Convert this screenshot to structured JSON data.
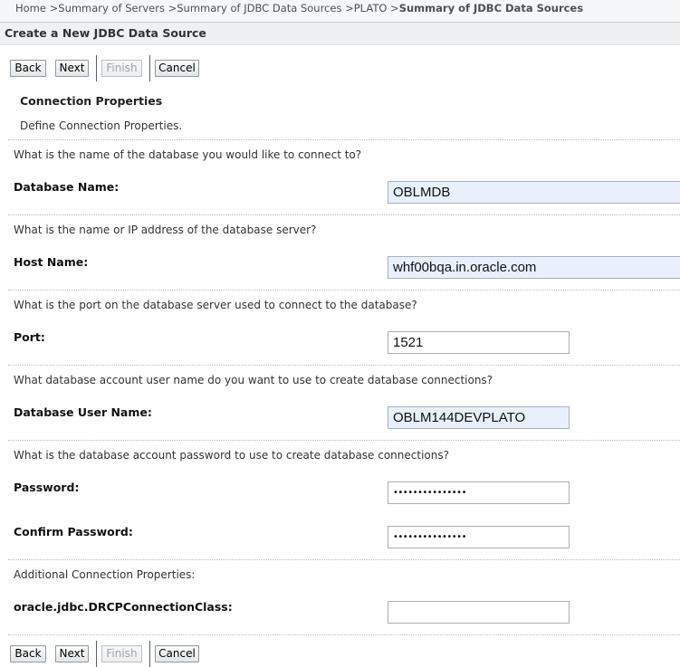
{
  "breadcrumb": {
    "items": [
      "Home",
      "Summary of Servers",
      "Summary of JDBC Data Sources",
      "PLATO"
    ],
    "separator": " >",
    "current": "Summary of JDBC Data Sources"
  },
  "page_title": "Create a New JDBC Data Source",
  "buttons": {
    "back": "Back",
    "next": "Next",
    "finish": "Finish",
    "cancel": "Cancel"
  },
  "section": {
    "title": "Connection Properties",
    "description": "Define Connection Properties."
  },
  "fields": {
    "database_name": {
      "question": "What is the name of the database you would like to connect to?",
      "label": "Database Name:",
      "value": "OBLMDB"
    },
    "host_name": {
      "question": "What is the name or IP address of the database server?",
      "label": "Host Name:",
      "value": "whf00bqa.in.oracle.com"
    },
    "port": {
      "question": "What is the port on the database server used to connect to the database?",
      "label": "Port:",
      "value": "1521"
    },
    "db_user": {
      "question": "What database account user name do you want to use to create database connections?",
      "label": "Database User Name:",
      "value": "OBLM144DEVPLATO"
    },
    "password": {
      "question": "What is the database account password to use to create database connections?",
      "label": "Password:",
      "value": "•••••••••••••••"
    },
    "confirm_password": {
      "label": "Confirm Password:",
      "value": "•••••••••••••••"
    },
    "drcp": {
      "question": "Additional Connection Properties:",
      "label": "oracle.jdbc.DRCPConnectionClass:",
      "value": ""
    }
  },
  "colors": {
    "autofill_bg": "#e8f0fe",
    "header_bg": "#eef0f2",
    "disabled_text": "#9da3a8"
  }
}
